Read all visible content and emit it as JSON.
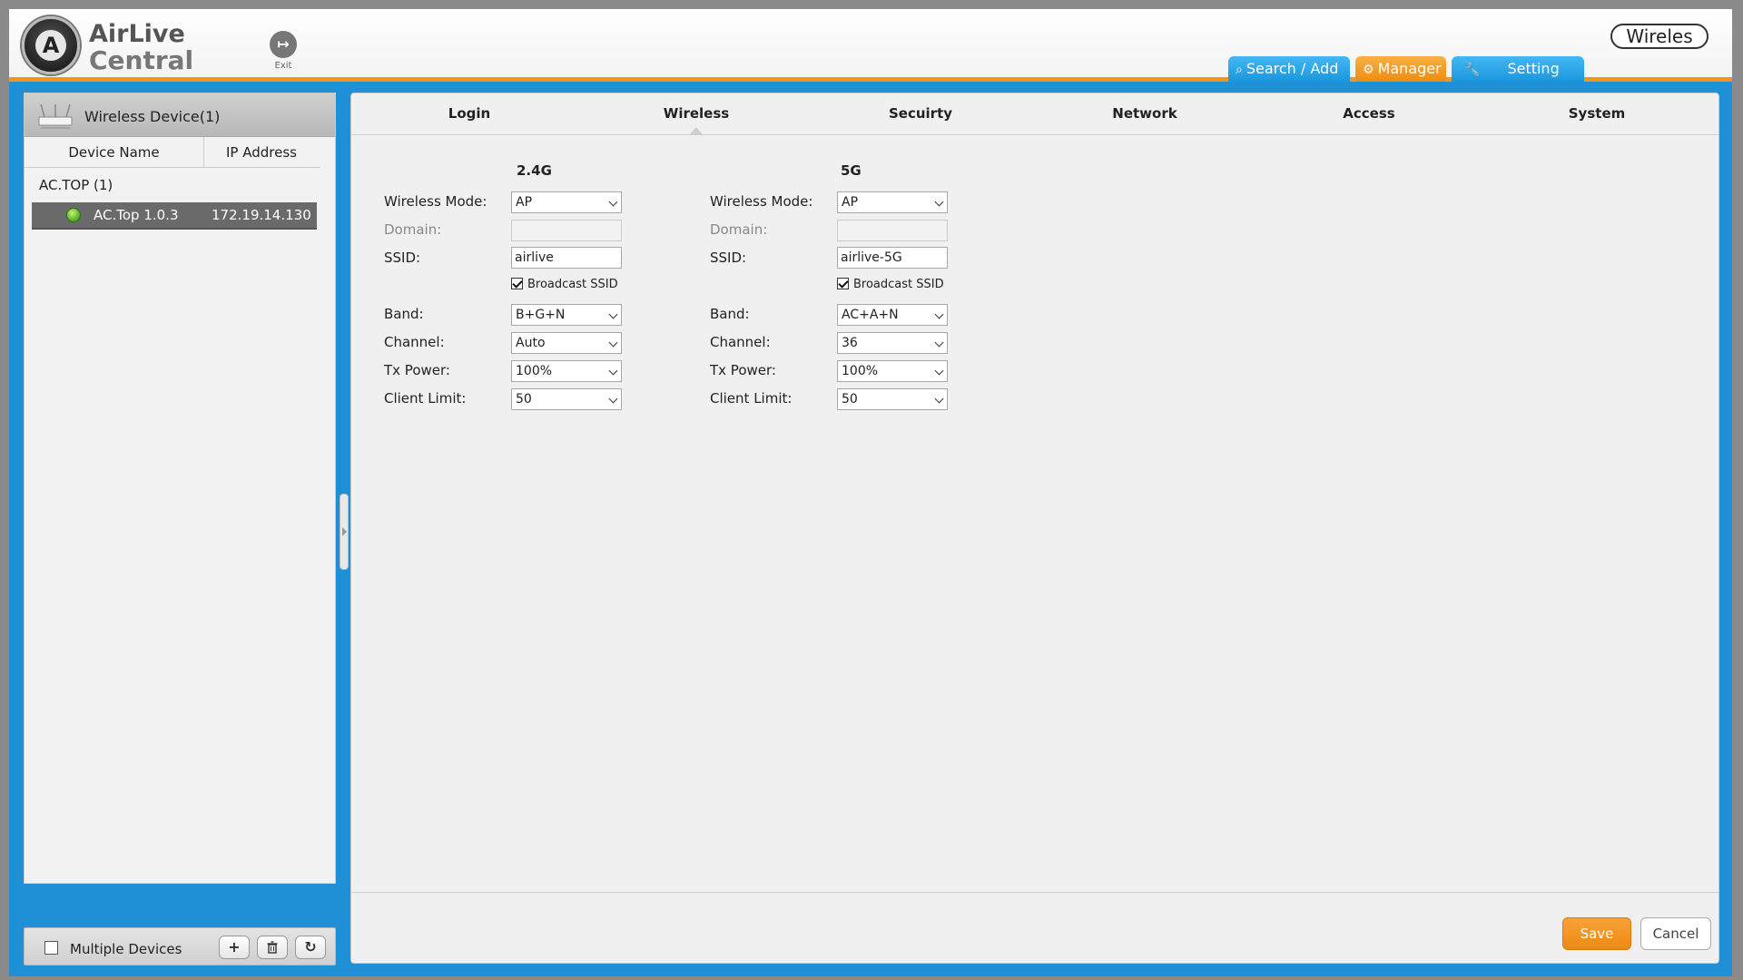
{
  "header": {
    "brand_line1": "AirLive",
    "brand_line2": "Central",
    "exit_label": "Exit",
    "top_badge": "Wireles",
    "nav_tabs": [
      {
        "label": "Search / Add",
        "icon": "search-icon"
      },
      {
        "label": "Manager",
        "icon": "gear-icon"
      },
      {
        "label": "Setting",
        "icon": "wrench-icon"
      }
    ],
    "active_tab": "Manager"
  },
  "sidebar": {
    "title": "Wireless Device(1)",
    "columns": [
      "Device Name",
      "IP Address"
    ],
    "group": "AC.TOP (1)",
    "devices": [
      {
        "name": "AC.Top 1.0.3",
        "ip": "172.19.14.130",
        "status": "online"
      }
    ],
    "footer": {
      "multiple_label": "Multiple Devices",
      "multiple_checked": false
    }
  },
  "main": {
    "tabs": [
      "Login",
      "Wireless",
      "Secuirty",
      "Network",
      "Access",
      "System"
    ],
    "active_tab": "Wireless",
    "labels": {
      "wireless_mode": "Wireless Mode:",
      "domain": "Domain:",
      "ssid": "SSID:",
      "broadcast_ssid": "Broadcast SSID",
      "band": "Band:",
      "channel": "Channel:",
      "tx_power": "Tx Power:",
      "client_limit": "Client Limit:"
    },
    "band_24": {
      "title": "2.4G",
      "wireless_mode": "AP",
      "domain": "",
      "ssid": "airlive",
      "broadcast_ssid": true,
      "band": "B+G+N",
      "channel": "Auto",
      "tx_power": "100%",
      "client_limit": "50"
    },
    "band_5": {
      "title": "5G",
      "wireless_mode": "AP",
      "domain": "",
      "ssid": "airlive-5G",
      "broadcast_ssid": true,
      "band": "AC+A+N",
      "channel": "36",
      "tx_power": "100%",
      "client_limit": "50"
    },
    "save_label": "Save",
    "cancel_label": "Cancel"
  },
  "colors": {
    "accent_orange": "#ee8a10",
    "accent_blue": "#1f8fd6",
    "status_online": "#5cb82a"
  }
}
